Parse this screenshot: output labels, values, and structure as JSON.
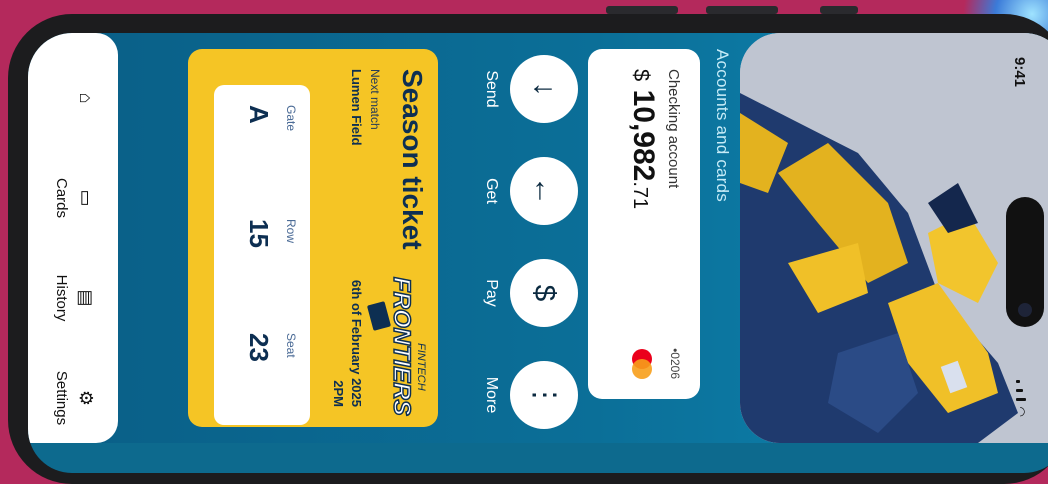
{
  "status": {
    "time": "9:41"
  },
  "accounts": {
    "section_title": "Accounts and cards",
    "checking": {
      "label": "Checking account",
      "currency": "$",
      "amount_main": "10,982",
      "amount_cents": ".71",
      "card_number": "•0206"
    }
  },
  "actions": [
    {
      "label": "Send",
      "icon": "arrow-down-icon",
      "glyph": "↓"
    },
    {
      "label": "Get",
      "icon": "arrow-left-icon",
      "glyph": "←"
    },
    {
      "label": "Pay",
      "icon": "dollar-icon",
      "glyph": "$"
    },
    {
      "label": "More",
      "icon": "more-dots-icon",
      "glyph": "⋮"
    }
  ],
  "ticket": {
    "title": "Season ticket",
    "next_label": "Next match",
    "venue": "Lumen Field",
    "date": "6th of February 2025",
    "time": "2PM",
    "logo_top": "FINTECH",
    "logo_main": "FRONTIERS",
    "gate_label": "Gate",
    "gate_value": "A",
    "row_label": "Row",
    "row_value": "15",
    "seat_label": "Seat",
    "seat_value": "23"
  },
  "nav": [
    {
      "label": "",
      "icon": "home-icon"
    },
    {
      "label": "Cards",
      "icon": "cards-icon"
    },
    {
      "label": "History",
      "icon": "history-icon"
    },
    {
      "label": "Settings",
      "icon": "gear-icon"
    }
  ],
  "colors": {
    "background": "#b4295c",
    "app_bg": "#0b6f98",
    "ticket": "#f5c525",
    "ticket_text": "#0d2f52"
  }
}
